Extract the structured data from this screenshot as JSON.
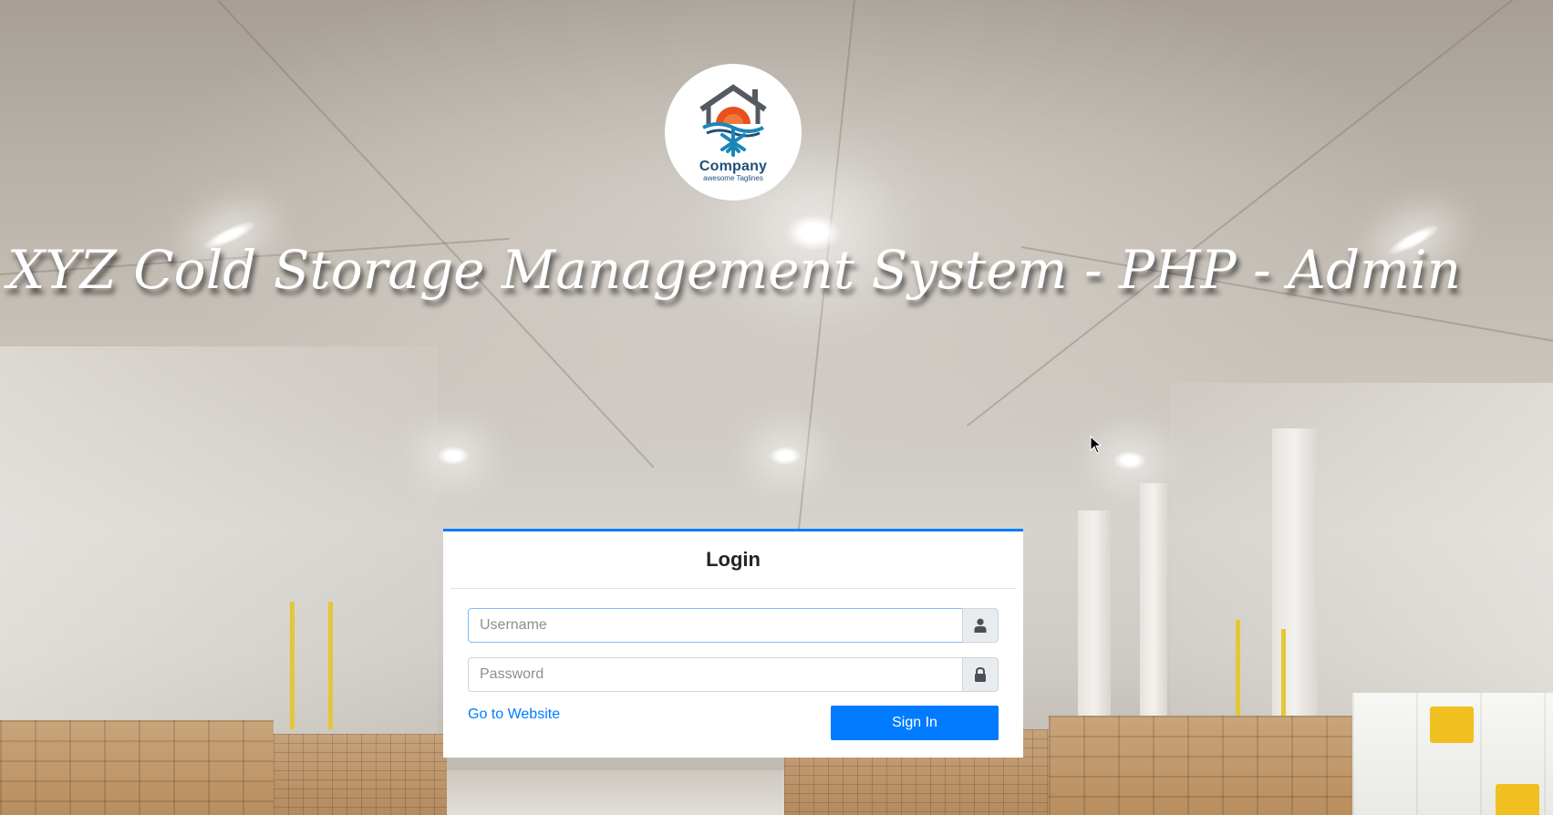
{
  "page": {
    "title": "XYZ Cold Storage Management System - PHP - Admin"
  },
  "logo": {
    "name": "Company",
    "tagline": "awesome Taglines"
  },
  "login": {
    "heading": "Login",
    "username_placeholder": "Username",
    "username_value": "",
    "password_placeholder": "Password",
    "password_value": "",
    "website_link": "Go to Website",
    "signin_label": "Sign In"
  },
  "colors": {
    "accent": "#007bff",
    "logo_text": "#1e4f7a",
    "logo_orange": "#e8501e",
    "logo_blue": "#1a86b8",
    "logo_gray": "#555a60"
  },
  "icons": {
    "username_addon": "user-icon",
    "password_addon": "lock-icon"
  }
}
